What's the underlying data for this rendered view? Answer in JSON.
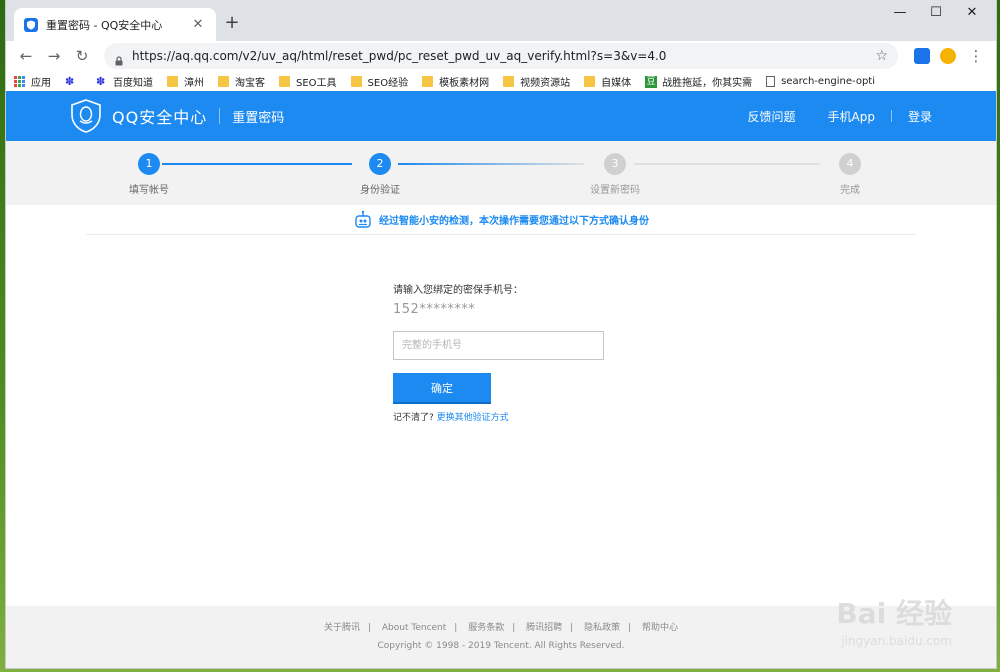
{
  "browser": {
    "tab_title": "重置密码 - QQ安全中心",
    "url": "https://aq.qq.com/v2/uv_aq/html/reset_pwd/pc_reset_pwd_uv_aq_verify.html?s=3&v=4.0",
    "bookmarks": [
      "应用",
      "百度知道",
      "漳州",
      "淘宝客",
      "SEO工具",
      "SEO经验",
      "模板素材网",
      "视频资源站",
      "自媒体",
      "战胜拖延，你其实需",
      "search-engine-opti"
    ],
    "icons": {
      "back": "back-arrow-icon",
      "forward": "forward-arrow-icon",
      "reload": "reload-icon",
      "lock": "lock-icon",
      "star": "star-icon",
      "menu": "more-vert-icon"
    }
  },
  "header": {
    "brand": "QQ安全中心",
    "subtitle": "重置密码",
    "links": [
      "反馈问题",
      "手机App",
      "登录"
    ],
    "color": "#1c8af0"
  },
  "steps": [
    {
      "num": "1",
      "label": "填写帐号",
      "state": "done"
    },
    {
      "num": "2",
      "label": "身份验证",
      "state": "active"
    },
    {
      "num": "3",
      "label": "设置新密码",
      "state": "pending"
    },
    {
      "num": "4",
      "label": "完成",
      "state": "pending"
    }
  ],
  "notice": "经过智能小安的检测，本次操作需要您通过以下方式确认身份",
  "form": {
    "label": "请输入您绑定的密保手机号：",
    "masked_phone": "152********",
    "placeholder": "完整的手机号",
    "value": "",
    "submit": "确定",
    "forgot": "记不清了?",
    "alt_link": "更换其他验证方式"
  },
  "footer": {
    "links": [
      "关于腾讯",
      "About Tencent",
      "服务条款",
      "腾讯招聘",
      "隐私政策",
      "帮助中心"
    ],
    "copyright": "Copyright © 1998 - 2019 Tencent. All Rights Reserved."
  },
  "watermark": {
    "text": "Bai 经验",
    "url": "jingyan.baidu.com"
  }
}
